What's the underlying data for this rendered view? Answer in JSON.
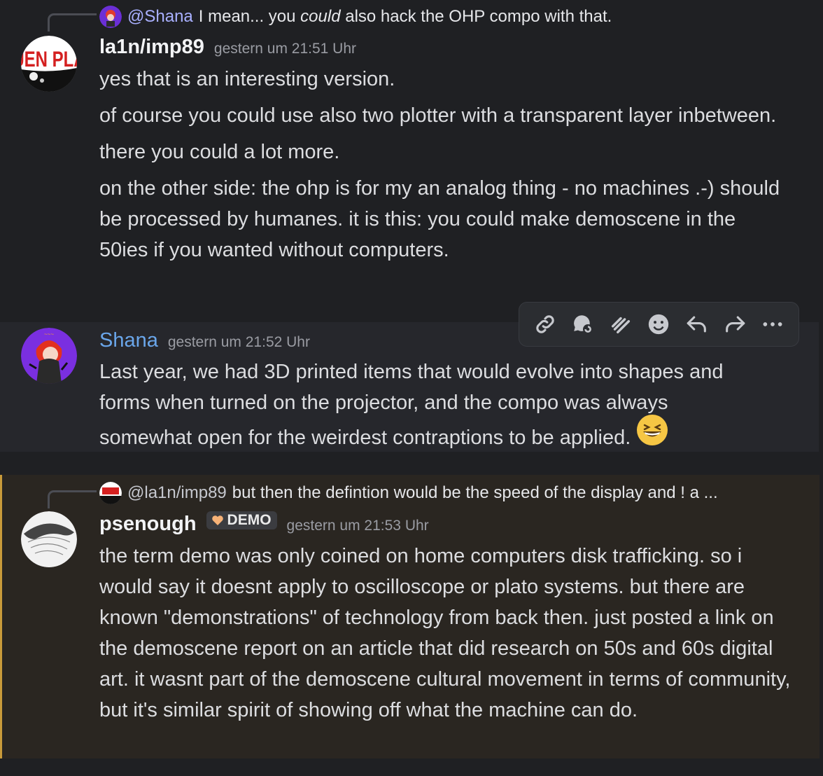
{
  "messages": [
    {
      "reply": {
        "mention": "@Shana",
        "text_pre": "I mean... you ",
        "text_em": "could",
        "text_post": " also hack the OHP compo with that."
      },
      "author": "la1n/imp89",
      "timestamp": "gestern um 21:51 Uhr",
      "avatar_text": "UEN PLA",
      "paragraphs": [
        "yes that is an interesting version.",
        "of course you could use also two plotter with a transparent layer inbetween.",
        "there you could a lot more.",
        "on the other side: the ohp is for my an analog thing - no machines .-) should be processed by humanes. it is this: you could make demoscene in the 50ies if you wanted without computers."
      ]
    },
    {
      "author": "Shana",
      "timestamp": "gestern um 21:52 Uhr",
      "text": "Last year, we had 3D printed items that would evolve into shapes and forms when turned on the projector, and the compo was always somewhat open for the weirdest contraptions to be applied.",
      "emoji": "grinning-squinting-face"
    },
    {
      "reply": {
        "mention": "@la1n/imp89",
        "text": "but then the defintion would be the speed of the display and ! a ..."
      },
      "author": "psenough",
      "tag": "DEMO",
      "timestamp": "gestern um 21:53 Uhr",
      "text": "the term demo was only coined on home computers disk trafficking. so i would say it doesnt apply to oscilloscope or plato systems. but there are known \"demonstrations\" of technology from back then. just posted a link on the demoscene report on an article that did research on 50s and 60s digital art. it wasnt part of the demoscene cultural movement in terms of community, but it's similar spirit of showing off what the machine can do."
    }
  ],
  "hover_actions": [
    "copy-link",
    "create-thread",
    "apps",
    "add-reaction",
    "reply",
    "forward",
    "more"
  ],
  "colors": {
    "background": "#1f2023",
    "highlight": "#26272c",
    "mention_highlight": "#2a2621",
    "mention_bar": "#c89a3a",
    "blue_name": "#6aa6ea"
  }
}
